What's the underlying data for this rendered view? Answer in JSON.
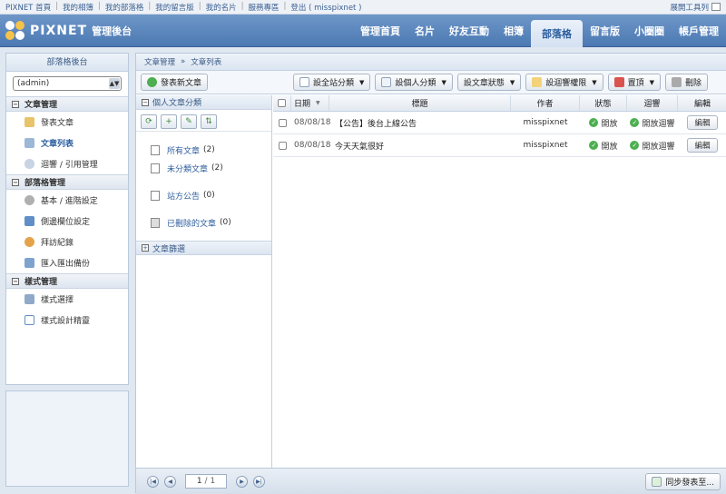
{
  "topbar": {
    "links": [
      "PIXNET 首頁",
      "我的相簿",
      "我的部落格",
      "我的留言版",
      "我的名片",
      "服務專區",
      "登出 ( misspixnet )"
    ],
    "right_label": "展開工具列"
  },
  "header": {
    "brand": "PIXNET",
    "subtitle": "管理後台",
    "nav": [
      "管理首頁",
      "名片",
      "好友互動",
      "相簿",
      "部落格",
      "留言版",
      "小圈圈",
      "帳戶管理"
    ],
    "active_nav": "部落格"
  },
  "sidebar": {
    "title": "部落格後台",
    "select_value": "(admin)",
    "sections": [
      {
        "label": "文章管理",
        "items": [
          {
            "label": "發表文章",
            "icon": "pencil-icon"
          },
          {
            "label": "文章列表",
            "icon": "document-list-icon",
            "active": true
          },
          {
            "label": "迴響 / 引用管理",
            "icon": "comment-icon"
          }
        ]
      },
      {
        "label": "部落格管理",
        "items": [
          {
            "label": "基本 / 進階設定",
            "icon": "gear-icon"
          },
          {
            "label": "側邊欄位設定",
            "icon": "sidebar-layout-icon"
          },
          {
            "label": "拜訪紀錄",
            "icon": "visitors-icon"
          },
          {
            "label": "匯入匯出備份",
            "icon": "import-export-icon"
          }
        ]
      },
      {
        "label": "樣式管理",
        "items": [
          {
            "label": "樣式選擇",
            "icon": "layout-icon"
          },
          {
            "label": "樣式設計精靈",
            "icon": "code-icon"
          }
        ]
      }
    ]
  },
  "breadcrumb": {
    "root": "文章管理",
    "separator": "»",
    "current": "文章列表"
  },
  "toolbar": {
    "new_post": "發表新文章",
    "set_site_category": "設全站分類",
    "set_personal_category": "設個人分類",
    "set_status": "設文章狀態",
    "set_comment_permission": "設迴響權限",
    "pin": "置頂",
    "delete": "刪除"
  },
  "categories": {
    "header": "個人文章分類",
    "items": [
      {
        "label": "所有文章",
        "count": "(2)"
      },
      {
        "label": "未分類文章",
        "count": "(2)"
      },
      {
        "label": "站方公告",
        "count": "(0)"
      },
      {
        "label": "已刪除的文章",
        "count": "(0)"
      }
    ],
    "filter_label": "文章篩選"
  },
  "table": {
    "headers": {
      "date": "日期",
      "title": "標題",
      "author": "作者",
      "status": "狀態",
      "responses": "迴響",
      "edit": "編輯"
    },
    "rows": [
      {
        "date": "08/08/18",
        "title": "【公告】後台上線公告",
        "author": "misspixnet",
        "status": "開放",
        "responses": "開放迴響",
        "edit": "編輯"
      },
      {
        "date": "08/08/18",
        "title": "今天天氣很好",
        "author": "misspixnet",
        "status": "開放",
        "responses": "開放迴響",
        "edit": "編輯"
      }
    ]
  },
  "pager": {
    "page": "1",
    "total": "/ 1"
  },
  "sync_button": "同步發表至..."
}
